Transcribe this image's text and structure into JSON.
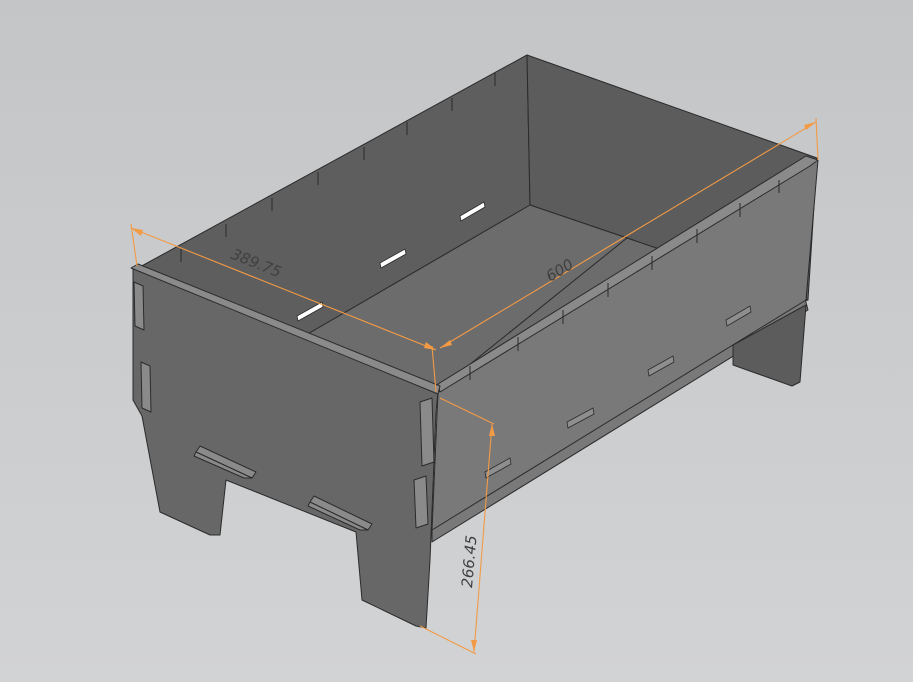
{
  "scene": {
    "type": "3d-cad-model-viewport",
    "colors": {
      "background_top": "#c3c5c7",
      "background_bottom": "#d2d3d5",
      "panel_front": "#676767",
      "panel_side": "#797979",
      "panel_inner_back": "#5e5e5e",
      "panel_inner_right": "#5c5c5c",
      "floor": "#6c6c6c",
      "edge": "#2b2b2b",
      "dimension_line": "#f39a45"
    }
  },
  "dimensions": {
    "width": {
      "label": "389.75"
    },
    "length": {
      "label": "600"
    },
    "height": {
      "label": "266.45"
    }
  }
}
